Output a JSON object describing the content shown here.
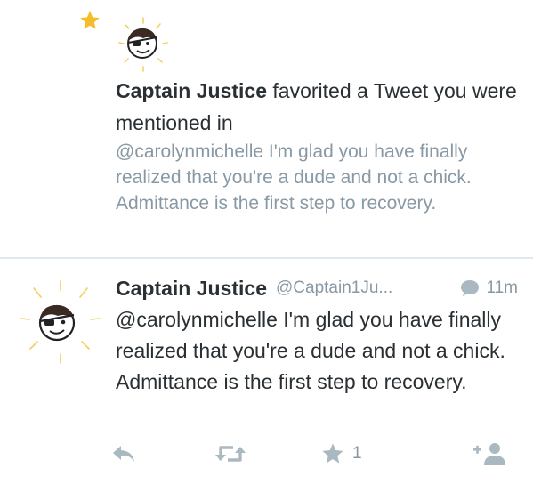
{
  "notification": {
    "actor": "Captain Justice",
    "action": "favorited a Tweet you were mentioned in",
    "tweet_text": "@carolynmichelle I'm glad you have finally realized that you're a dude and not a chick. Admittance is the first step to recovery.",
    "star_icon": "star-icon",
    "star_color": "#f6bd2b"
  },
  "tweet": {
    "name": "Captain Justice",
    "handle": "@Captain1Ju...",
    "time": "11m",
    "text": "@carolynmichelle I'm glad you have finally realized that you're a dude and not a chick. Admittance is the first step to recovery.",
    "actions": {
      "reply_icon": "reply-icon",
      "retweet_icon": "retweet-icon",
      "favorite_icon": "star-icon",
      "favorite_count": "1",
      "follow_icon": "follow-icon"
    }
  },
  "colors": {
    "text": "#292f33",
    "muted": "#8899a6",
    "icon": "#aab8c2",
    "divider": "#e1e8ed",
    "avatar_rays": "#f3cf5b"
  }
}
